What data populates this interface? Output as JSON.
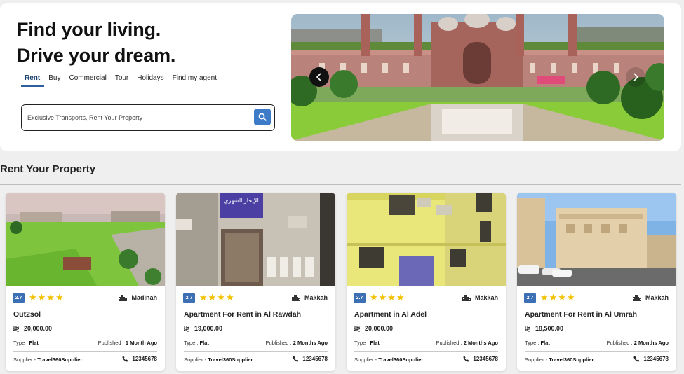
{
  "hero": {
    "headline_1": "Find your living.",
    "headline_2": "Drive your dream.",
    "tabs": [
      {
        "label": "Rent",
        "active": true
      },
      {
        "label": "Buy",
        "active": false
      },
      {
        "label": "Commercial",
        "active": false
      },
      {
        "label": "Tour",
        "active": false
      },
      {
        "label": "Holidays",
        "active": false
      },
      {
        "label": "Find my agent",
        "active": false
      }
    ],
    "search": {
      "placeholder": "Exclusive Transports, Rent Your Property",
      "value": ""
    },
    "carousel": {
      "prev_icon": "chevron-left-icon",
      "next_icon": "chevron-right-icon"
    }
  },
  "section": {
    "title": "Rent Your Property"
  },
  "labels": {
    "type_prefix": "Type : ",
    "published_prefix": "Published : ",
    "supplier_prefix": "Supplier - "
  },
  "cards": [
    {
      "rating": "2.7",
      "stars": "★★★★",
      "city": "Madinah",
      "title": "Out2sol",
      "price": "20,000.00",
      "type": "Flat",
      "published": "1 Month Ago",
      "supplier": "Travel360Supplier",
      "phone": "12345678"
    },
    {
      "rating": "2.7",
      "stars": "★★★★",
      "city": "Makkah",
      "title": "Apartment For Rent in Al Rawdah",
      "price": "19,000.00",
      "type": "Flat",
      "published": "2 Months Ago",
      "supplier": "Travel360Supplier",
      "phone": "12345678"
    },
    {
      "rating": "2.7",
      "stars": "★★★★",
      "city": "Makkah",
      "title": "Apartment in Al Adel",
      "price": "20,000.00",
      "type": "Flat",
      "published": "2 Months Ago",
      "supplier": "Travel360Supplier",
      "phone": "12345678"
    },
    {
      "rating": "2.7",
      "stars": "★★★★",
      "city": "Makkah",
      "title": "Apartment For Rent in Al Umrah",
      "price": "18,500.00",
      "type": "Flat",
      "published": "2 Months Ago",
      "supplier": "Travel360Supplier",
      "phone": "12345678"
    }
  ],
  "images": {
    "sign_text": "للإيجار الشهري"
  },
  "colors": {
    "accent": "#3d7ac8",
    "badge": "#3d6fb5",
    "star": "#f2c200"
  }
}
